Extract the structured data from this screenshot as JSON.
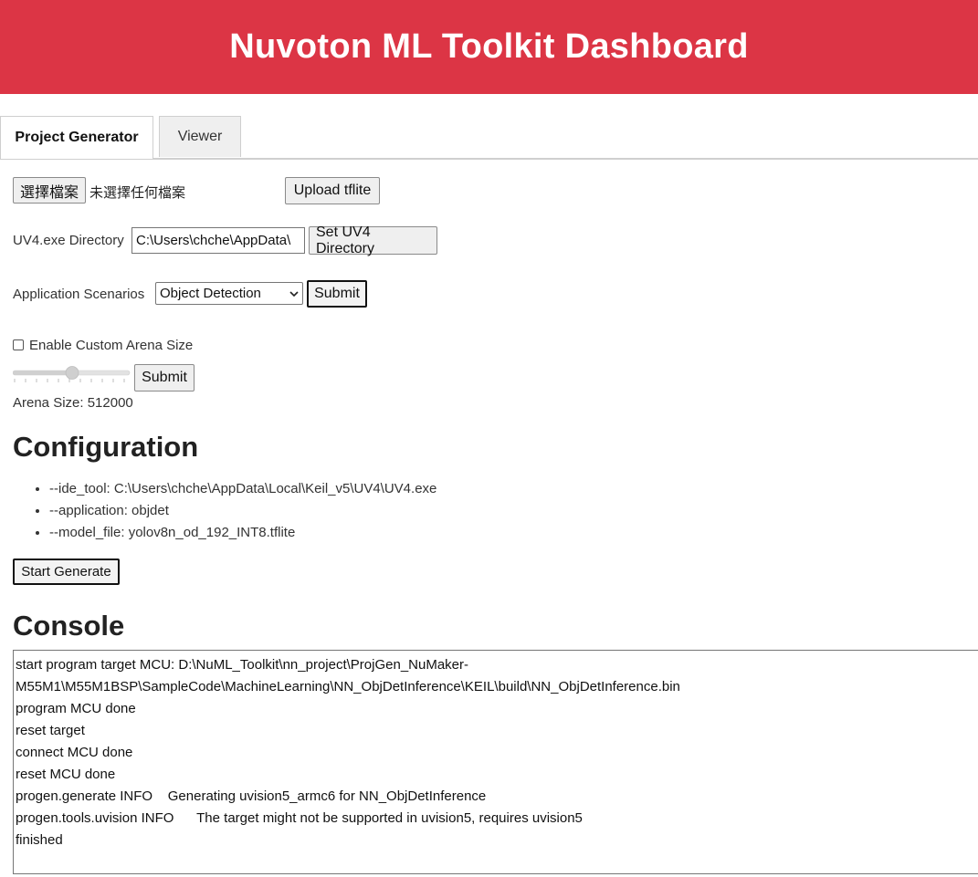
{
  "header": {
    "title": "Nuvoton ML Toolkit Dashboard"
  },
  "tabs": [
    {
      "label": "Project Generator",
      "active": true
    },
    {
      "label": "Viewer",
      "active": false
    }
  ],
  "upload": {
    "choose_file_label": "選擇檔案",
    "no_file_text": "未選擇任何檔案",
    "upload_button": "Upload tflite"
  },
  "uv4": {
    "label": "UV4.exe Directory",
    "value": "C:\\Users\\chche\\AppData\\",
    "button": "Set UV4 Directory"
  },
  "scenario": {
    "label": "Application Scenarios",
    "selected": "Object Detection",
    "submit": "Submit"
  },
  "arena": {
    "checkbox_label": "Enable Custom Arena Size",
    "checked": false,
    "slider_level": 0.5,
    "submit": "Submit",
    "size_text": "Arena Size: 512000"
  },
  "configuration": {
    "heading": "Configuration",
    "items": [
      "--ide_tool: C:\\Users\\chche\\AppData\\Local\\Keil_v5\\UV4\\UV4.exe",
      "--application: objdet",
      "--model_file: yolov8n_od_192_INT8.tflite"
    ],
    "start_button": "Start Generate"
  },
  "console": {
    "heading": "Console",
    "lines": [
      "start program target MCU: D:\\NuML_Toolkit\\nn_project\\ProjGen_NuMaker-",
      "M55M1\\M55M1BSP\\SampleCode\\MachineLearning\\NN_ObjDetInference\\KEIL\\build\\NN_ObjDetInference.bin",
      "program MCU done",
      "reset target",
      "connect MCU done",
      "reset MCU done",
      "progen.generate INFO    Generating uvision5_armc6 for NN_ObjDetInference",
      "progen.tools.uvision INFO      The target might not be supported in uvision5, requires uvision5",
      "finished"
    ]
  },
  "colors": {
    "header_bg": "#dc3545"
  }
}
